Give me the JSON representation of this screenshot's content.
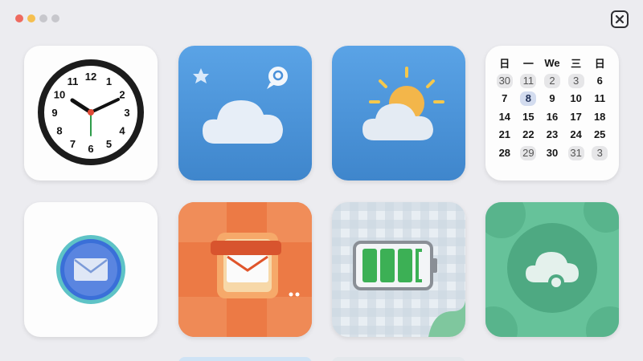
{
  "window": {
    "traffic_lights": [
      "#ee6a5f",
      "#f5bf4f",
      "#c7c7cc",
      "#c7c7cc"
    ],
    "close_icon": "close-icon"
  },
  "clock": {
    "icon": "clock-icon",
    "numerals": [
      "12",
      "1",
      "2",
      "3",
      "4",
      "5",
      "6",
      "7",
      "8",
      "9",
      "10",
      "11"
    ]
  },
  "weather_cloud": {
    "icon": "cloud-icon",
    "badges": [
      "star-icon",
      "chat-bubble-icon"
    ]
  },
  "weather_sun": {
    "icon": "partly-sunny-icon"
  },
  "calendar": {
    "headers": [
      "日",
      "一",
      "We",
      "三",
      "日"
    ],
    "rows": [
      [
        "30",
        "11",
        "2",
        "3",
        "6"
      ],
      [
        "7",
        "8",
        "9",
        "10",
        "11"
      ],
      [
        "14",
        "15",
        "16",
        "17",
        "18"
      ],
      [
        "21",
        "22",
        "23",
        "24",
        "25"
      ],
      [
        "28",
        "29",
        "30",
        "31",
        "3"
      ]
    ],
    "muted": [
      "0-0",
      "0-1",
      "0-2",
      "0-3",
      "4-1",
      "4-3",
      "4-4"
    ],
    "today": "1-1"
  },
  "mail_round": {
    "icon": "mail-icon"
  },
  "mail_box": {
    "icon": "mailbox-icon"
  },
  "battery": {
    "icon": "battery-icon",
    "charge_fraction": 0.78
  },
  "cloud_green": {
    "icon": "cloud-sync-icon"
  },
  "colors": {
    "blue_tile": "#4a95d9",
    "orange_tile": "#ec7a45",
    "green_tile": "#66c29a"
  }
}
